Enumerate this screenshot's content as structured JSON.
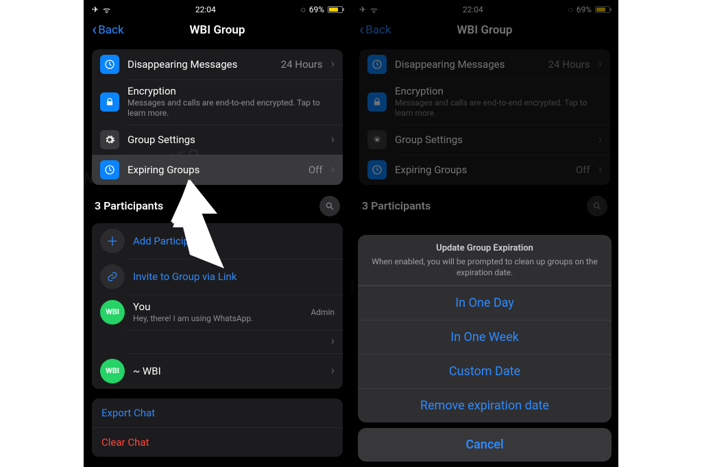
{
  "status": {
    "time": "22:04",
    "battery_pct": "69%",
    "airplane_glyph": "✈",
    "wifi_glyph": "ᯤ",
    "loading_glyph": "◌"
  },
  "nav": {
    "back_label": "Back",
    "back_chevron": "‹",
    "title": "WBI Group"
  },
  "settings": {
    "disappearing": {
      "label": "Disappearing Messages",
      "value": "24 Hours"
    },
    "encryption": {
      "label": "Encryption",
      "subtitle": "Messages and calls are end-to-end encrypted. Tap to learn more."
    },
    "group_settings": {
      "label": "Group Settings"
    },
    "expiring": {
      "label": "Expiring Groups",
      "value": "Off"
    }
  },
  "participants": {
    "header": "3 Participants",
    "add_label": "Add Participants",
    "invite_label": "Invite to Group via Link",
    "you": {
      "name": "You",
      "status": "Hey, there! I am using WhatsApp.",
      "role": "Admin",
      "avatar": "WBI"
    },
    "wbi": {
      "name": "~ WBI",
      "avatar": "WBI"
    }
  },
  "actions": {
    "export": "Export Chat",
    "clear": "Clear Chat"
  },
  "sheet": {
    "title": "Update Group Expiration",
    "description": "When enabled, you will be prompted to clean up groups on the expiration date.",
    "options": {
      "one_day": "In One Day",
      "one_week": "In One Week",
      "custom": "Custom Date",
      "remove": "Remove expiration date"
    },
    "cancel": "Cancel"
  },
  "watermark": "©WABETAINFO",
  "icons": {
    "lock": "🔒",
    "gear": "⚙",
    "timer": "⏱",
    "search": "🔍",
    "plus": "＋",
    "link": "🔗"
  }
}
